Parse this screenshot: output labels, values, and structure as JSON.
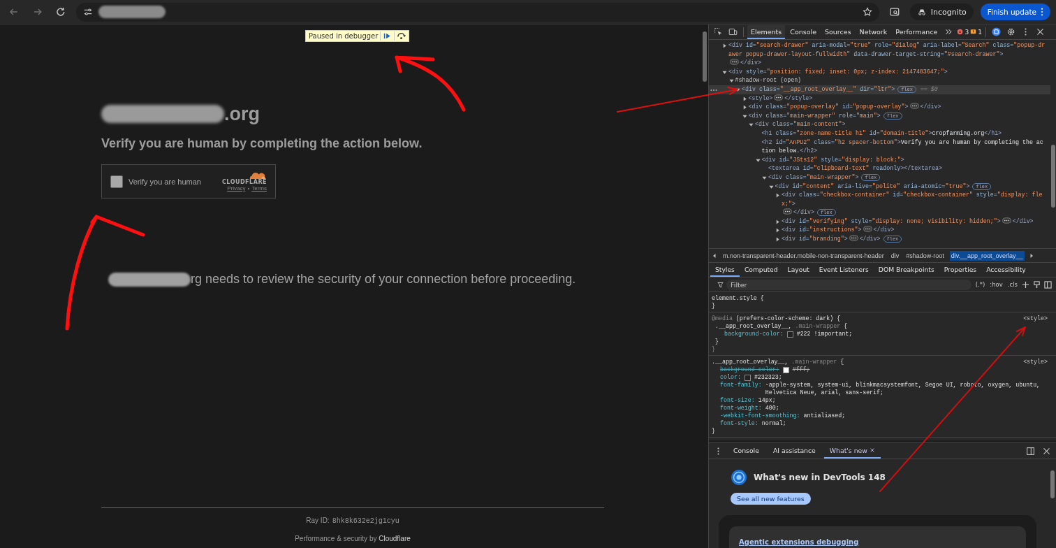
{
  "browser": {
    "incognito_label": "Incognito",
    "update_button": "Finish update"
  },
  "page": {
    "debugger_banner": "Paused in debugger",
    "title_visible": ".org",
    "subtitle": "Verify you are human by completing the action below.",
    "widget": {
      "checked": false,
      "label": "Verify you are human",
      "brand": "CLOUDFLARE",
      "links": [
        "Privacy",
        "Terms"
      ],
      "separator": "•"
    },
    "message_visible": "rg needs to review the security of your connection before proceeding.",
    "ray_id": {
      "label": "Ray ID:",
      "value": "8hk8k632e2jg1cyu"
    },
    "footer": "Performance & security by **Cloudflare**"
  },
  "devtools": {
    "tabs": [
      {
        "label": "Elements",
        "selected": true
      },
      {
        "label": "Console",
        "selected": false
      },
      {
        "label": "Sources",
        "selected": false
      },
      {
        "label": "Network",
        "selected": false
      },
      {
        "label": "Performance",
        "selected": false
      }
    ],
    "error_count": "3",
    "warning_count": "1",
    "dom": [
      {
        "selected": false,
        "expanded": false,
        "open": [
          {
            "kind": "tag",
            "text": "<div"
          },
          {
            "kind": "attr",
            "text": " id="
          },
          {
            "kind": "value",
            "text": "\"search-drawer\""
          },
          {
            "kind": "attr",
            "text": " aria-modal="
          },
          {
            "kind": "value",
            "text": "\"true\""
          },
          {
            "kind": "attr",
            "text": " role="
          },
          {
            "kind": "value",
            "text": "\"dialog\""
          },
          {
            "kind": "attr",
            "text": " aria-label="
          },
          {
            "kind": "value",
            "text": "\"Search\""
          },
          {
            "kind": "attr",
            "text": " class="
          },
          {
            "kind": "value",
            "text": "\"popup-drawer popup-drawer-layout-fullwidth\""
          },
          {
            "kind": "attr",
            "text": " data-drawer-target-string="
          },
          {
            "kind": "value",
            "text": "\"#search-drawer\""
          },
          {
            "kind": "tag",
            "text": ">"
          }
        ],
        "close": [
          {
            "kind": "tag",
            "text": "</div>"
          }
        ]
      },
      {
        "selected": false,
        "expanded": true,
        "open": [
          {
            "kind": "tag",
            "text": "<div"
          },
          {
            "kind": "attr",
            "text": " style="
          },
          {
            "kind": "value",
            "text": "\"position: fixed; inset: 0px; z-index: 2147483647;\""
          },
          {
            "kind": "tag",
            "text": ">"
          }
        ],
        "children": [
          {
            "selected": false,
            "expanded": true,
            "open": [
              {
                "kind": "shadow",
                "text": "#shadow-root (open)"
              }
            ],
            "children": [
              {
                "selected": true,
                "expanded": true,
                "badge": "flex",
                "marker": "== $0",
                "open": [
                  {
                    "kind": "tag",
                    "text": "<div"
                  },
                  {
                    "kind": "attr",
                    "text": " class="
                  },
                  {
                    "kind": "value",
                    "text": "\"__app_root_overlay__\""
                  },
                  {
                    "kind": "attr",
                    "text": " dir="
                  },
                  {
                    "kind": "value",
                    "text": "\"ltr\""
                  },
                  {
                    "kind": "tag",
                    "text": ">"
                  }
                ],
                "children": [
                  {
                    "selected": false,
                    "expanded": false,
                    "open": [
                      {
                        "kind": "tag",
                        "text": "<style>"
                      }
                    ],
                    "close": [
                      {
                        "kind": "tag",
                        "text": "</style>"
                      }
                    ]
                  },
                  {
                    "selected": false,
                    "expanded": false,
                    "open": [
                      {
                        "kind": "tag",
                        "text": "<div"
                      },
                      {
                        "kind": "attr",
                        "text": " class="
                      },
                      {
                        "kind": "value",
                        "text": "\"popup-overlay\""
                      },
                      {
                        "kind": "attr",
                        "text": " id="
                      },
                      {
                        "kind": "value",
                        "text": "\"popup-overlay\""
                      },
                      {
                        "kind": "tag",
                        "text": ">"
                      }
                    ],
                    "close": [
                      {
                        "kind": "tag",
                        "text": "</div>"
                      }
                    ]
                  },
                  {
                    "selected": false,
                    "expanded": true,
                    "badge": "flex",
                    "open": [
                      {
                        "kind": "tag",
                        "text": "<div"
                      },
                      {
                        "kind": "attr",
                        "text": " class="
                      },
                      {
                        "kind": "value",
                        "text": "\"main-wrapper\""
                      },
                      {
                        "kind": "attr",
                        "text": " role="
                      },
                      {
                        "kind": "value",
                        "text": "\"main\""
                      },
                      {
                        "kind": "tag",
                        "text": ">"
                      }
                    ],
                    "children": [
                      {
                        "selected": false,
                        "expanded": true,
                        "open": [
                          {
                            "kind": "tag",
                            "text": "<div"
                          },
                          {
                            "kind": "attr",
                            "text": " class="
                          },
                          {
                            "kind": "value",
                            "text": "\"main-content\""
                          },
                          {
                            "kind": "tag",
                            "text": ">"
                          }
                        ],
                        "children": [
                          {
                            "selected": false,
                            "open": [
                              {
                                "kind": "tag",
                                "text": "<h1"
                              },
                              {
                                "kind": "attr",
                                "text": " class="
                              },
                              {
                                "kind": "value",
                                "text": "\"zone-name-title h1\""
                              },
                              {
                                "kind": "attr",
                                "text": " id="
                              },
                              {
                                "kind": "value",
                                "text": "\"domain-title\""
                              },
                              {
                                "kind": "tag",
                                "text": ">"
                              },
                              {
                                "kind": "text",
                                "text": "cropfarming.org"
                              },
                              {
                                "kind": "tag",
                                "text": "</h1>"
                              }
                            ]
                          },
                          {
                            "selected": false,
                            "open": [
                              {
                                "kind": "tag",
                                "text": "<h2"
                              },
                              {
                                "kind": "attr",
                                "text": " id="
                              },
                              {
                                "kind": "value",
                                "text": "\"AnPU2\""
                              },
                              {
                                "kind": "attr",
                                "text": " class="
                              },
                              {
                                "kind": "value",
                                "text": "\"h2 spacer-bottom\""
                              },
                              {
                                "kind": "tag",
                                "text": ">"
                              },
                              {
                                "kind": "text",
                                "text": "Verify you are human by completing the action below."
                              },
                              {
                                "kind": "tag",
                                "text": "</h2>"
                              }
                            ]
                          },
                          {
                            "selected": false,
                            "expanded": true,
                            "open": [
                              {
                                "kind": "tag",
                                "text": "<div"
                              },
                              {
                                "kind": "attr",
                                "text": " id="
                              },
                              {
                                "kind": "value",
                                "text": "\"JSts12\""
                              },
                              {
                                "kind": "attr",
                                "text": " style="
                              },
                              {
                                "kind": "value",
                                "text": "\"display: block;\""
                              },
                              {
                                "kind": "tag",
                                "text": ">"
                              }
                            ],
                            "children": [
                              {
                                "selected": false,
                                "open": [
                                  {
                                    "kind": "tag",
                                    "text": "<textarea"
                                  },
                                  {
                                    "kind": "attr",
                                    "text": " id="
                                  },
                                  {
                                    "kind": "value",
                                    "text": "\"clipboard-text\""
                                  },
                                  {
                                    "kind": "attr",
                                    "text": " readonly"
                                  },
                                  {
                                    "kind": "tag",
                                    "text": "></textarea>"
                                  }
                                ]
                              },
                              {
                                "selected": false,
                                "expanded": true,
                                "badge": "flex",
                                "open": [
                                  {
                                    "kind": "tag",
                                    "text": "<div"
                                  },
                                  {
                                    "kind": "attr",
                                    "text": " class="
                                  },
                                  {
                                    "kind": "value",
                                    "text": "\"main-wrapper\""
                                  },
                                  {
                                    "kind": "tag",
                                    "text": ">"
                                  }
                                ],
                                "children": [
                                  {
                                    "selected": false,
                                    "expanded": true,
                                    "badge": "flex",
                                    "open": [
                                      {
                                        "kind": "tag",
                                        "text": "<div"
                                      },
                                      {
                                        "kind": "attr",
                                        "text": " id="
                                      },
                                      {
                                        "kind": "value",
                                        "text": "\"content\""
                                      },
                                      {
                                        "kind": "attr",
                                        "text": " aria-live="
                                      },
                                      {
                                        "kind": "value",
                                        "text": "\"polite\""
                                      },
                                      {
                                        "kind": "attr",
                                        "text": " aria-atomic="
                                      },
                                      {
                                        "kind": "value",
                                        "text": "\"true\""
                                      },
                                      {
                                        "kind": "tag",
                                        "text": ">"
                                      }
                                    ],
                                    "children": [
                                      {
                                        "selected": false,
                                        "expanded": false,
                                        "badge": "flex",
                                        "open": [
                                          {
                                            "kind": "tag",
                                            "text": "<div"
                                          },
                                          {
                                            "kind": "attr",
                                            "text": " class="
                                          },
                                          {
                                            "kind": "value",
                                            "text": "\"checkbox-container\""
                                          },
                                          {
                                            "kind": "attr",
                                            "text": " id="
                                          },
                                          {
                                            "kind": "value",
                                            "text": "\"checkbox-container\""
                                          },
                                          {
                                            "kind": "attr",
                                            "text": " style="
                                          },
                                          {
                                            "kind": "value",
                                            "text": "\"display: flex;\""
                                          },
                                          {
                                            "kind": "tag",
                                            "text": ">"
                                          }
                                        ],
                                        "close": [
                                          {
                                            "kind": "tag",
                                            "text": "</div>"
                                          }
                                        ]
                                      },
                                      {
                                        "selected": false,
                                        "expanded": false,
                                        "open": [
                                          {
                                            "kind": "tag",
                                            "text": "<div"
                                          },
                                          {
                                            "kind": "attr",
                                            "text": " id="
                                          },
                                          {
                                            "kind": "value",
                                            "text": "\"verifying\""
                                          },
                                          {
                                            "kind": "attr",
                                            "text": " style="
                                          },
                                          {
                                            "kind": "value",
                                            "text": "\"display: none; visibility: hidden;\""
                                          },
                                          {
                                            "kind": "tag",
                                            "text": ">"
                                          }
                                        ],
                                        "close": [
                                          {
                                            "kind": "tag",
                                            "text": "</div>"
                                          }
                                        ]
                                      },
                                      {
                                        "selected": false,
                                        "expanded": false,
                                        "open": [
                                          {
                                            "kind": "tag",
                                            "text": "<div"
                                          },
                                          {
                                            "kind": "attr",
                                            "text": " id="
                                          },
                                          {
                                            "kind": "value",
                                            "text": "\"instructions\""
                                          },
                                          {
                                            "kind": "tag",
                                            "text": ">"
                                          }
                                        ],
                                        "close": [
                                          {
                                            "kind": "tag",
                                            "text": "</div>"
                                          }
                                        ]
                                      },
                                      {
                                        "selected": false,
                                        "expanded": false,
                                        "badge": "flex",
                                        "open": [
                                          {
                                            "kind": "tag",
                                            "text": "<div"
                                          },
                                          {
                                            "kind": "attr",
                                            "text": " id="
                                          },
                                          {
                                            "kind": "value",
                                            "text": "\"branding\""
                                          },
                                          {
                                            "kind": "tag",
                                            "text": ">"
                                          }
                                        ],
                                        "close": [
                                          {
                                            "kind": "tag",
                                            "text": "</div>"
                                          }
                                        ]
                                      }
                                    ]
                                  }
                                ]
                              }
                            ]
                          }
                        ]
                      }
                    ]
                  }
                ]
              }
            ]
          }
        ]
      }
    ],
    "breadcrumbs": [
      {
        "label": "m.non-transparent-header.mobile-non-transparent-header",
        "selected": false
      },
      {
        "label": "div",
        "selected": false
      },
      {
        "label": "#shadow-root",
        "selected": false
      },
      {
        "label": "div.__app_root_overlay__",
        "selected": true
      }
    ],
    "styles_tabs": [
      {
        "label": "Styles",
        "selected": true
      },
      {
        "label": "Computed",
        "selected": false
      },
      {
        "label": "Layout",
        "selected": false
      },
      {
        "label": "Event Listeners",
        "selected": false
      },
      {
        "label": "DOM Breakpoints",
        "selected": false
      },
      {
        "label": "Properties",
        "selected": false
      },
      {
        "label": "Accessibility",
        "selected": false
      }
    ],
    "filter": {
      "placeholder": "Filter"
    },
    "filter_tools": [
      "(.*)",
      ":hov",
      ".cls"
    ],
    "rules": [
      {
        "selector": [
          {
            "kind": "plain",
            "text": "element.style"
          },
          {
            "kind": "plain",
            "text": "{"
          }
        ],
        "close": "}"
      },
      {
        "media": [
          {
            "kind": "at",
            "text": "@media"
          },
          {
            "kind": "plain",
            "text": "(prefers-color-scheme: dark) {"
          }
        ],
        "source": "<style>",
        "selector": [
          {
            "kind": "plain",
            "text": ".__app_root_overlay__,"
          },
          {
            "kind": "dim",
            "text": ".main-wrapper"
          },
          {
            "kind": "plain",
            "text": "{"
          }
        ],
        "declarations": [
          {
            "name": "background-color:",
            "value": "#222 !important;",
            "color": "#222222",
            "overridden": false
          }
        ],
        "close": "}",
        "media_close": "}"
      },
      {
        "source": "<style>",
        "selector": [
          {
            "kind": "plain",
            "text": ".__app_root_overlay__,"
          },
          {
            "kind": "dim",
            "text": ".main-wrapper"
          },
          {
            "kind": "plain",
            "text": "{"
          }
        ],
        "declarations": [
          {
            "name": "background-color:",
            "value": "#fff;",
            "color": "#ffffff",
            "overridden": true
          },
          {
            "name": "color:",
            "value": "#232323;",
            "color": "#232323",
            "overridden": false
          },
          {
            "name": "font-family:",
            "value": "-apple-system, system-ui, blinkmacsystemfont, Segoe UI, roboto, oxygen, ubuntu, Helvetica Neue, arial, sans-serif;",
            "overridden": false
          },
          {
            "name": "font-size:",
            "value": "14px;",
            "overridden": false
          },
          {
            "name": "font-weight:",
            "value": "400;",
            "overridden": false
          },
          {
            "name": "-webkit-font-smoothing:",
            "value": "antialiased;",
            "overridden": false
          },
          {
            "name": "font-style:",
            "value": "normal;",
            "overridden": false
          }
        ],
        "close": "}"
      }
    ],
    "drawer": {
      "tabs": [
        {
          "label": "Console",
          "selected": false,
          "closable": false
        },
        {
          "label": "AI assistance",
          "selected": false,
          "closable": false
        },
        {
          "label": "What's new",
          "selected": true,
          "closable": true
        }
      ],
      "whats_new": {
        "heading": "What's new in DevTools 148",
        "button": "See all new features",
        "card_link": "Agentic extensions debugging"
      }
    }
  }
}
